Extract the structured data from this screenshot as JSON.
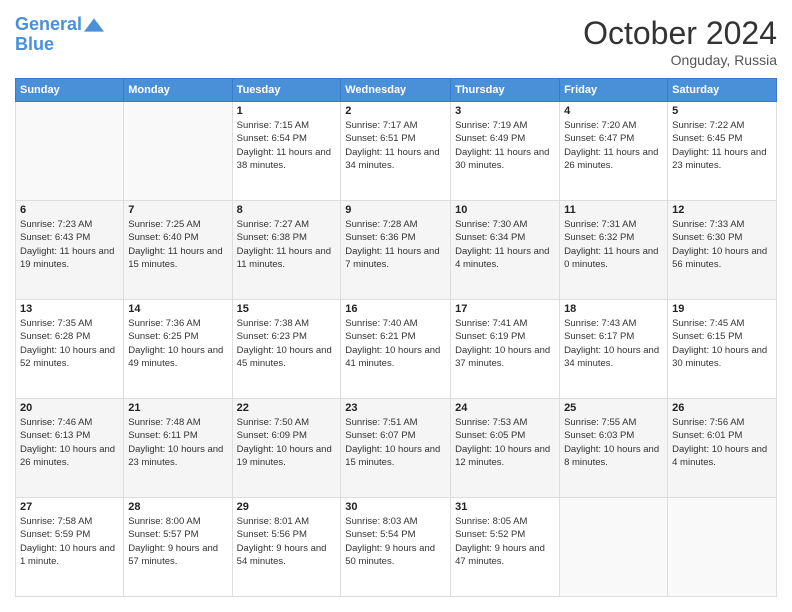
{
  "header": {
    "logo_line1": "General",
    "logo_line2": "Blue",
    "month": "October 2024",
    "location": "Onguday, Russia"
  },
  "weekdays": [
    "Sunday",
    "Monday",
    "Tuesday",
    "Wednesday",
    "Thursday",
    "Friday",
    "Saturday"
  ],
  "weeks": [
    [
      {
        "day": "",
        "info": ""
      },
      {
        "day": "",
        "info": ""
      },
      {
        "day": "1",
        "info": "Sunrise: 7:15 AM\nSunset: 6:54 PM\nDaylight: 11 hours and 38 minutes."
      },
      {
        "day": "2",
        "info": "Sunrise: 7:17 AM\nSunset: 6:51 PM\nDaylight: 11 hours and 34 minutes."
      },
      {
        "day": "3",
        "info": "Sunrise: 7:19 AM\nSunset: 6:49 PM\nDaylight: 11 hours and 30 minutes."
      },
      {
        "day": "4",
        "info": "Sunrise: 7:20 AM\nSunset: 6:47 PM\nDaylight: 11 hours and 26 minutes."
      },
      {
        "day": "5",
        "info": "Sunrise: 7:22 AM\nSunset: 6:45 PM\nDaylight: 11 hours and 23 minutes."
      }
    ],
    [
      {
        "day": "6",
        "info": "Sunrise: 7:23 AM\nSunset: 6:43 PM\nDaylight: 11 hours and 19 minutes."
      },
      {
        "day": "7",
        "info": "Sunrise: 7:25 AM\nSunset: 6:40 PM\nDaylight: 11 hours and 15 minutes."
      },
      {
        "day": "8",
        "info": "Sunrise: 7:27 AM\nSunset: 6:38 PM\nDaylight: 11 hours and 11 minutes."
      },
      {
        "day": "9",
        "info": "Sunrise: 7:28 AM\nSunset: 6:36 PM\nDaylight: 11 hours and 7 minutes."
      },
      {
        "day": "10",
        "info": "Sunrise: 7:30 AM\nSunset: 6:34 PM\nDaylight: 11 hours and 4 minutes."
      },
      {
        "day": "11",
        "info": "Sunrise: 7:31 AM\nSunset: 6:32 PM\nDaylight: 11 hours and 0 minutes."
      },
      {
        "day": "12",
        "info": "Sunrise: 7:33 AM\nSunset: 6:30 PM\nDaylight: 10 hours and 56 minutes."
      }
    ],
    [
      {
        "day": "13",
        "info": "Sunrise: 7:35 AM\nSunset: 6:28 PM\nDaylight: 10 hours and 52 minutes."
      },
      {
        "day": "14",
        "info": "Sunrise: 7:36 AM\nSunset: 6:25 PM\nDaylight: 10 hours and 49 minutes."
      },
      {
        "day": "15",
        "info": "Sunrise: 7:38 AM\nSunset: 6:23 PM\nDaylight: 10 hours and 45 minutes."
      },
      {
        "day": "16",
        "info": "Sunrise: 7:40 AM\nSunset: 6:21 PM\nDaylight: 10 hours and 41 minutes."
      },
      {
        "day": "17",
        "info": "Sunrise: 7:41 AM\nSunset: 6:19 PM\nDaylight: 10 hours and 37 minutes."
      },
      {
        "day": "18",
        "info": "Sunrise: 7:43 AM\nSunset: 6:17 PM\nDaylight: 10 hours and 34 minutes."
      },
      {
        "day": "19",
        "info": "Sunrise: 7:45 AM\nSunset: 6:15 PM\nDaylight: 10 hours and 30 minutes."
      }
    ],
    [
      {
        "day": "20",
        "info": "Sunrise: 7:46 AM\nSunset: 6:13 PM\nDaylight: 10 hours and 26 minutes."
      },
      {
        "day": "21",
        "info": "Sunrise: 7:48 AM\nSunset: 6:11 PM\nDaylight: 10 hours and 23 minutes."
      },
      {
        "day": "22",
        "info": "Sunrise: 7:50 AM\nSunset: 6:09 PM\nDaylight: 10 hours and 19 minutes."
      },
      {
        "day": "23",
        "info": "Sunrise: 7:51 AM\nSunset: 6:07 PM\nDaylight: 10 hours and 15 minutes."
      },
      {
        "day": "24",
        "info": "Sunrise: 7:53 AM\nSunset: 6:05 PM\nDaylight: 10 hours and 12 minutes."
      },
      {
        "day": "25",
        "info": "Sunrise: 7:55 AM\nSunset: 6:03 PM\nDaylight: 10 hours and 8 minutes."
      },
      {
        "day": "26",
        "info": "Sunrise: 7:56 AM\nSunset: 6:01 PM\nDaylight: 10 hours and 4 minutes."
      }
    ],
    [
      {
        "day": "27",
        "info": "Sunrise: 7:58 AM\nSunset: 5:59 PM\nDaylight: 10 hours and 1 minute."
      },
      {
        "day": "28",
        "info": "Sunrise: 8:00 AM\nSunset: 5:57 PM\nDaylight: 9 hours and 57 minutes."
      },
      {
        "day": "29",
        "info": "Sunrise: 8:01 AM\nSunset: 5:56 PM\nDaylight: 9 hours and 54 minutes."
      },
      {
        "day": "30",
        "info": "Sunrise: 8:03 AM\nSunset: 5:54 PM\nDaylight: 9 hours and 50 minutes."
      },
      {
        "day": "31",
        "info": "Sunrise: 8:05 AM\nSunset: 5:52 PM\nDaylight: 9 hours and 47 minutes."
      },
      {
        "day": "",
        "info": ""
      },
      {
        "day": "",
        "info": ""
      }
    ]
  ]
}
